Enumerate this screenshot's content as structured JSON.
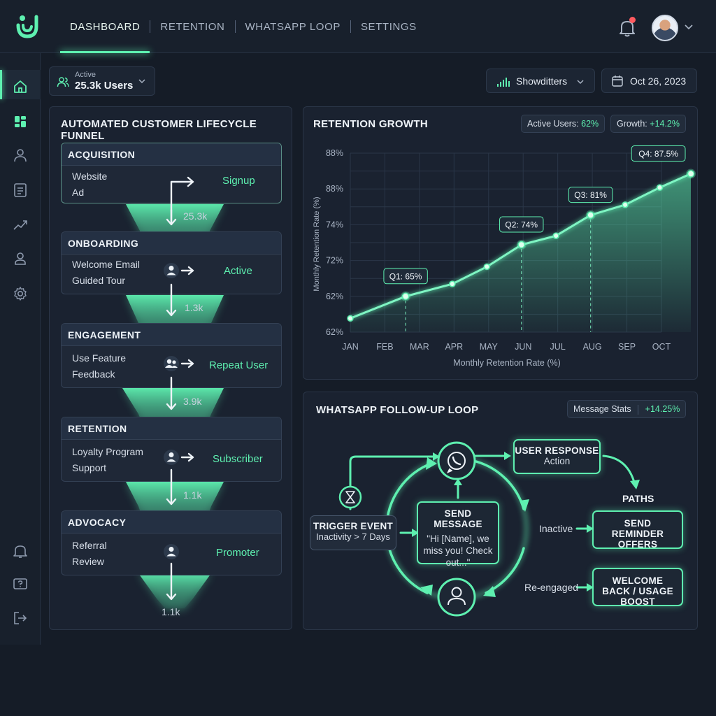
{
  "nav": {
    "items": [
      {
        "label": "DASHBOARD",
        "active": true
      },
      {
        "label": "RETENTION",
        "active": false
      },
      {
        "label": "WHATSAPP LOOP",
        "active": false
      },
      {
        "label": "SETTINGS",
        "active": false
      }
    ],
    "notification_dot_color": "#ff5a5f"
  },
  "sidebar": {
    "icons": [
      "home-icon",
      "grid-icon",
      "user-icon",
      "document-icon",
      "trend-icon",
      "profile-icon",
      "gear-icon",
      "bell-icon",
      "help-icon",
      "logout-icon"
    ],
    "active": "grid-icon"
  },
  "toolbar": {
    "users_caption": "Active",
    "users_value": "25.3k Users",
    "filter_label": "Showditters",
    "date_label": "Oct 26, 2023"
  },
  "funnel": {
    "title": "AUTOMATED CUSTOMER LIFECYCLE FUNNEL",
    "stages": [
      {
        "name": "ACQUISITION",
        "items": [
          "Website",
          "Ad"
        ],
        "outcome": "Signup",
        "count": "25.3k"
      },
      {
        "name": "ONBOARDING",
        "items": [
          "Welcome Email",
          "Guided Tour"
        ],
        "outcome": "Active",
        "count": "1.3k"
      },
      {
        "name": "ENGAGEMENT",
        "items": [
          "Use Feature",
          "Feedback"
        ],
        "outcome": "Repeat User",
        "count": "3.9k"
      },
      {
        "name": "RETENTION",
        "items": [
          "Loyalty Program",
          "Support"
        ],
        "outcome": "Subscriber",
        "count": "1.1k"
      },
      {
        "name": "ADVOCACY",
        "items": [
          "Referral",
          "Review"
        ],
        "outcome": "Promoter",
        "count": "1.1k"
      }
    ]
  },
  "retention": {
    "title": "RETENTION GROWTH",
    "badge_active_label": "Active Users:",
    "badge_active_value": "62%",
    "badge_growth_label": "Growth:",
    "badge_growth_value": "+14.2%"
  },
  "chart_data": {
    "type": "area",
    "x": [
      "JAN",
      "FEB",
      "MAR",
      "APR",
      "MAY",
      "JUN",
      "JUL",
      "AUG",
      "SEP",
      "OCT"
    ],
    "y_tick_labels": [
      "62%",
      "62%",
      "72%",
      "74%",
      "88%",
      "88%"
    ],
    "series": [
      {
        "values": [
          62,
          65.2,
          67,
          69.5,
          72.7,
          74,
          77,
          78.5,
          81,
          83
        ]
      }
    ],
    "point_positions": [
      0,
      1.6,
      2.95,
      3.95,
      4.95,
      5.95,
      6.95,
      7.95,
      8.95,
      9.85
    ],
    "annotations": [
      {
        "label": "Q1: 65%",
        "index": 1
      },
      {
        "label": "Q2: 74%",
        "index": 4
      },
      {
        "label": "Q3: 81%",
        "index": 6
      },
      {
        "label": "Q4: 87.5%",
        "index": 9
      }
    ],
    "xlabel": "Monthly Retention Rate (%)",
    "ylabel": "Monthly Retention Rate (%)",
    "ylim": [
      60,
      86
    ],
    "grid": true,
    "color": "#5ef0b0"
  },
  "whatsapp": {
    "title": "WHATSAPP FOLLOW-UP LOOP",
    "badge_label": "Message Stats",
    "badge_value": "+14.25%",
    "trigger_title": "TRIGGER EVENT",
    "trigger_sub": "Inactivity > 7 Days",
    "send_title": "SEND MESSAGE",
    "send_body": "\"Hi [Name], we miss you! Check out...\"",
    "response_title": "USER RESPONSE",
    "response_sub": "Action",
    "paths_label": "PATHS",
    "inactive_label": "Inactive",
    "reminder_label": "SEND REMINDER OFFERS",
    "reengaged_label": "Re-engaged",
    "welcome_label": "WELCOME BACK / USAGE BOOST"
  }
}
